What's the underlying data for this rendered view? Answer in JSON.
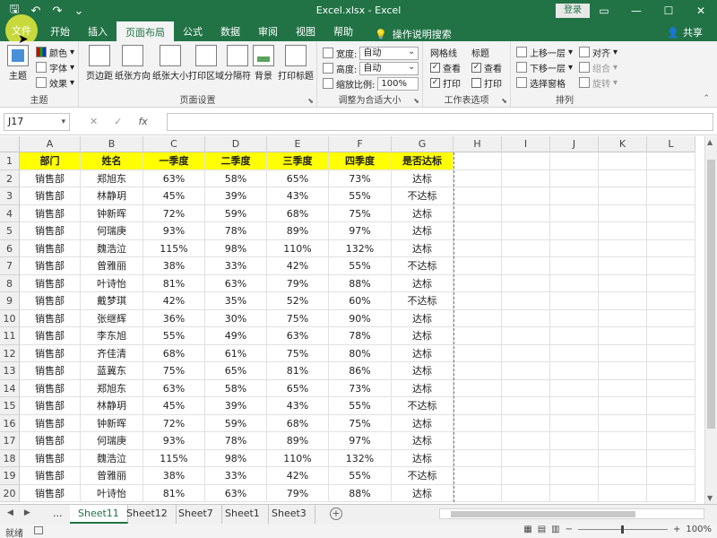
{
  "window": {
    "title": "Excel.xlsx - Excel",
    "login_label": "登录",
    "share_label": "共享"
  },
  "tabs": [
    "文件",
    "开始",
    "插入",
    "页面布局",
    "公式",
    "数据",
    "审阅",
    "视图",
    "帮助"
  ],
  "active_tab": "页面布局",
  "tell_me": "操作说明搜索",
  "ribbon": {
    "theme": {
      "themes": "主题",
      "colors": "颜色",
      "fonts": "字体",
      "effects": "效果",
      "label": "主题"
    },
    "page_setup": {
      "margins": "页边距",
      "orientation": "纸张方向",
      "size": "纸张大小",
      "print_area": "打印区域",
      "breaks": "分隔符",
      "background": "背景",
      "print_titles": "打印标题",
      "label": "页面设置"
    },
    "scale": {
      "width_label": "宽度:",
      "width_value": "自动",
      "height_label": "高度:",
      "height_value": "自动",
      "scale_label": "缩放比例:",
      "scale_value": "100%",
      "label": "调整为合适大小"
    },
    "sheet_options": {
      "gridlines": "网格线",
      "headings": "标题",
      "view1": "查看",
      "print1": "打印",
      "view2": "查看",
      "print2": "打印",
      "label": "工作表选项"
    },
    "arrange": {
      "bring_forward": "上移一层",
      "send_backward": "下移一层",
      "selection_pane": "选择窗格",
      "align": "对齐",
      "group": "组合",
      "rotate": "旋转",
      "label": "排列"
    }
  },
  "formula_bar": {
    "name_box": "J17",
    "fx": "fx",
    "cancel": "✕",
    "enter": "✓"
  },
  "columns": [
    "A",
    "B",
    "C",
    "D",
    "E",
    "F",
    "G",
    "H",
    "I",
    "J",
    "K",
    "L"
  ],
  "table": {
    "headers": [
      "部门",
      "姓名",
      "一季度",
      "二季度",
      "三季度",
      "四季度",
      "是否达标"
    ],
    "rows": [
      [
        "销售部",
        "郑旭东",
        "63%",
        "58%",
        "65%",
        "73%",
        "达标"
      ],
      [
        "销售部",
        "林静玥",
        "45%",
        "39%",
        "43%",
        "55%",
        "不达标"
      ],
      [
        "销售部",
        "钟新晖",
        "72%",
        "59%",
        "68%",
        "75%",
        "达标"
      ],
      [
        "销售部",
        "何瑞庚",
        "93%",
        "78%",
        "89%",
        "97%",
        "达标"
      ],
      [
        "销售部",
        "魏浩泣",
        "115%",
        "98%",
        "110%",
        "132%",
        "达标"
      ],
      [
        "销售部",
        "曾雅丽",
        "38%",
        "33%",
        "42%",
        "55%",
        "不达标"
      ],
      [
        "销售部",
        "叶诗怡",
        "81%",
        "63%",
        "79%",
        "88%",
        "达标"
      ],
      [
        "销售部",
        "戴梦琪",
        "42%",
        "35%",
        "52%",
        "60%",
        "不达标"
      ],
      [
        "销售部",
        "张继辉",
        "36%",
        "30%",
        "75%",
        "90%",
        "达标"
      ],
      [
        "销售部",
        "李东旭",
        "55%",
        "49%",
        "63%",
        "78%",
        "达标"
      ],
      [
        "销售部",
        "齐佳清",
        "68%",
        "61%",
        "75%",
        "80%",
        "达标"
      ],
      [
        "销售部",
        "蓝冀东",
        "75%",
        "65%",
        "81%",
        "86%",
        "达标"
      ],
      [
        "销售部",
        "郑旭东",
        "63%",
        "58%",
        "65%",
        "73%",
        "达标"
      ],
      [
        "销售部",
        "林静玥",
        "45%",
        "39%",
        "43%",
        "55%",
        "不达标"
      ],
      [
        "销售部",
        "钟新晖",
        "72%",
        "59%",
        "68%",
        "75%",
        "达标"
      ],
      [
        "销售部",
        "何瑞庚",
        "93%",
        "78%",
        "89%",
        "97%",
        "达标"
      ],
      [
        "销售部",
        "魏浩泣",
        "115%",
        "98%",
        "110%",
        "132%",
        "达标"
      ],
      [
        "销售部",
        "曾雅丽",
        "38%",
        "33%",
        "42%",
        "55%",
        "不达标"
      ],
      [
        "销售部",
        "叶诗怡",
        "81%",
        "63%",
        "79%",
        "88%",
        "达标"
      ]
    ]
  },
  "sheets": [
    "...",
    "Sheet11",
    "Sheet12",
    "Sheet7",
    "Sheet1",
    "Sheet3"
  ],
  "active_sheet": "Sheet11",
  "status": {
    "ready": "就绪",
    "zoom": "100%"
  },
  "colors": {
    "accent": "#217346",
    "header_fill": "#ffff00",
    "file_tab_highlight": "#c7d93b"
  }
}
